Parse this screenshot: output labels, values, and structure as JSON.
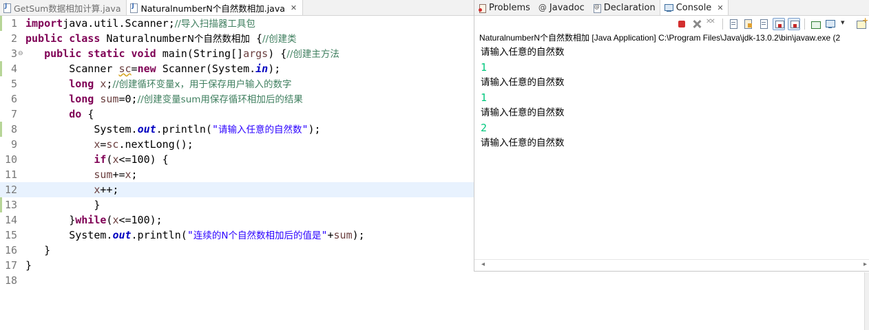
{
  "editor": {
    "tabs": [
      {
        "label": "GetSum数据相加计算.java",
        "active": false
      },
      {
        "label": "NaturalnumberN个自然数相加.java",
        "active": true
      }
    ],
    "close_glyph": "✕",
    "current_line": 12,
    "lines": [
      {
        "num": "1",
        "fold": "",
        "tokens": [
          [
            "kw",
            "import"
          ],
          [
            "",
            "java.util.Scanner;"
          ],
          [
            "cm",
            "//导入扫描器工具包"
          ]
        ]
      },
      {
        "num": "2",
        "fold": "",
        "tokens": [
          [
            "kw",
            "public class "
          ],
          [
            "",
            "Naturalnumber"
          ],
          [
            "cjk",
            "N个自然数相加"
          ],
          [
            "",
            " {"
          ],
          [
            "cm",
            "//创建类"
          ]
        ]
      },
      {
        "num": "3",
        "fold": "⊖",
        "tokens": [
          [
            "",
            " "
          ],
          [
            "kw",
            "  public static void "
          ],
          [
            "",
            "main(String[]"
          ],
          [
            "var",
            "args"
          ],
          [
            "",
            ") {"
          ],
          [
            "cm",
            "//创建主方法"
          ]
        ]
      },
      {
        "num": "4",
        "fold": "",
        "tokens": [
          [
            "",
            "       Scanner "
          ],
          [
            "var warn",
            "sc"
          ],
          [
            "",
            "="
          ],
          [
            "kw",
            "new "
          ],
          [
            "",
            "Scanner(System."
          ],
          [
            "fs",
            "in"
          ],
          [
            "",
            ");"
          ]
        ]
      },
      {
        "num": "5",
        "fold": "",
        "tokens": [
          [
            "",
            "       "
          ],
          [
            "kw",
            "long "
          ],
          [
            "var",
            "x"
          ],
          [
            "",
            ";"
          ],
          [
            "cm",
            "//创建循环变量x，用于保存用户输入的数字"
          ]
        ]
      },
      {
        "num": "6",
        "fold": "",
        "tokens": [
          [
            "",
            "       "
          ],
          [
            "kw",
            "long "
          ],
          [
            "var",
            "sum"
          ],
          [
            "",
            "=0;"
          ],
          [
            "cm",
            "//创建变量sum用保存循环相加后的结果"
          ]
        ]
      },
      {
        "num": "7",
        "fold": "",
        "tokens": [
          [
            "",
            "       "
          ],
          [
            "kw",
            "do "
          ],
          [
            "",
            "{"
          ]
        ]
      },
      {
        "num": "8",
        "fold": "",
        "tokens": [
          [
            "",
            "           System."
          ],
          [
            "fs",
            "out"
          ],
          [
            "",
            ".println("
          ],
          [
            "st",
            "\""
          ],
          [
            "stz",
            "请输入任意的自然数"
          ],
          [
            "st",
            "\""
          ],
          [
            "",
            ");"
          ]
        ]
      },
      {
        "num": "9",
        "fold": "",
        "tokens": [
          [
            "",
            "           "
          ],
          [
            "var",
            "x"
          ],
          [
            "",
            "="
          ],
          [
            "var",
            "sc"
          ],
          [
            "",
            ".nextLong();"
          ]
        ]
      },
      {
        "num": "10",
        "fold": "",
        "tokens": [
          [
            "",
            "           "
          ],
          [
            "kw",
            "if"
          ],
          [
            "",
            "("
          ],
          [
            "var",
            "x"
          ],
          [
            "",
            "<=100) {"
          ]
        ]
      },
      {
        "num": "11",
        "fold": "",
        "tokens": [
          [
            "",
            "           "
          ],
          [
            "var",
            "sum"
          ],
          [
            "",
            "+="
          ],
          [
            "var",
            "x"
          ],
          [
            "",
            ";"
          ]
        ]
      },
      {
        "num": "12",
        "fold": "",
        "tokens": [
          [
            "",
            "           "
          ],
          [
            "var",
            "x"
          ],
          [
            "",
            "++;"
          ]
        ]
      },
      {
        "num": "13",
        "fold": "",
        "tokens": [
          [
            "",
            "           }"
          ]
        ]
      },
      {
        "num": "14",
        "fold": "",
        "tokens": [
          [
            "",
            "       }"
          ],
          [
            "kw",
            "while"
          ],
          [
            "",
            "("
          ],
          [
            "var",
            "x"
          ],
          [
            "",
            "<=100);"
          ]
        ]
      },
      {
        "num": "15",
        "fold": "",
        "tokens": [
          [
            "",
            "       System."
          ],
          [
            "fs",
            "out"
          ],
          [
            "",
            ".println("
          ],
          [
            "st",
            "\""
          ],
          [
            "stz",
            "连续的N个自然数相加后的值是"
          ],
          [
            "st",
            "\""
          ],
          [
            "",
            "+"
          ],
          [
            "var",
            "sum"
          ],
          [
            "",
            ");"
          ]
        ]
      },
      {
        "num": "16",
        "fold": "",
        "tokens": [
          [
            "",
            "   }"
          ]
        ]
      },
      {
        "num": "17",
        "fold": "",
        "tokens": [
          [
            "",
            "}"
          ]
        ]
      },
      {
        "num": "18",
        "fold": "",
        "tokens": []
      }
    ]
  },
  "console_view": {
    "tabs": [
      {
        "label": "Problems",
        "icon": "problems-icon",
        "active": false
      },
      {
        "label": "Javadoc",
        "icon": "at-icon",
        "active": false
      },
      {
        "label": "Declaration",
        "icon": "declaration-icon",
        "active": false
      },
      {
        "label": "Console",
        "icon": "console-icon",
        "active": true
      }
    ],
    "launch_line": "NaturalnumberN个自然数相加 [Java Application] C:\\Program Files\\Java\\jdk-13.0.2\\bin\\javaw.exe (2",
    "output": [
      {
        "text": "请输入任意的自然数",
        "kind": "prompt"
      },
      {
        "text": "1",
        "kind": "input"
      },
      {
        "text": "请输入任意的自然数",
        "kind": "prompt"
      },
      {
        "text": "1",
        "kind": "input"
      },
      {
        "text": "请输入任意的自然数",
        "kind": "prompt"
      },
      {
        "text": "2",
        "kind": "input"
      },
      {
        "text": "请输入任意的自然数",
        "kind": "prompt"
      }
    ],
    "colors": {
      "input": "#00c87d",
      "terminate": "#d32f2f"
    }
  }
}
